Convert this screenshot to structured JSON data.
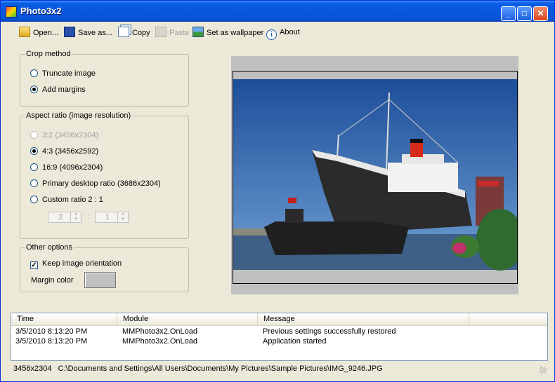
{
  "window": {
    "title": "Photo3x2"
  },
  "toolbar": {
    "open": "Open...",
    "save_as": "Save as...",
    "copy": "Copy",
    "paste": "Paste",
    "set_wallpaper": "Set as wallpaper",
    "about": "About"
  },
  "crop_method": {
    "legend": "Crop method",
    "truncate": "Truncate image",
    "add_margins": "Add margins",
    "selected": "add_margins"
  },
  "aspect_ratio": {
    "legend": "Aspect ratio (image resolution)",
    "r32": "3:2 (3456x2304)",
    "r43": "4:3 (3456x2592)",
    "r169": "16:9 (4096x2304)",
    "primary": "Primary desktop ratio (3686x2304)",
    "custom": "Custom ratio 2 : 1",
    "custom_w": "2",
    "custom_sep": ":",
    "custom_h": "1",
    "selected": "r43"
  },
  "other_options": {
    "legend": "Other options",
    "keep_orientation": "Keep image orientation",
    "keep_orientation_checked": true,
    "margin_color_label": "Margin color",
    "margin_color": "#c0c0c0"
  },
  "log": {
    "columns": [
      "Time",
      "Module",
      "Message"
    ],
    "rows": [
      {
        "time": "3/5/2010 8:13:20 PM",
        "module": "MMPhoto3x2.OnLoad",
        "message": "Previous settings successfully restored"
      },
      {
        "time": "3/5/2010 8:13:20 PM",
        "module": "MMPhoto3x2.OnLoad",
        "message": "Application started"
      }
    ]
  },
  "status": {
    "resolution": "3456x2304",
    "path": "C:\\Documents and Settings\\All Users\\Documents\\My Pictures\\Sample Pictures\\IMG_9246.JPG"
  }
}
